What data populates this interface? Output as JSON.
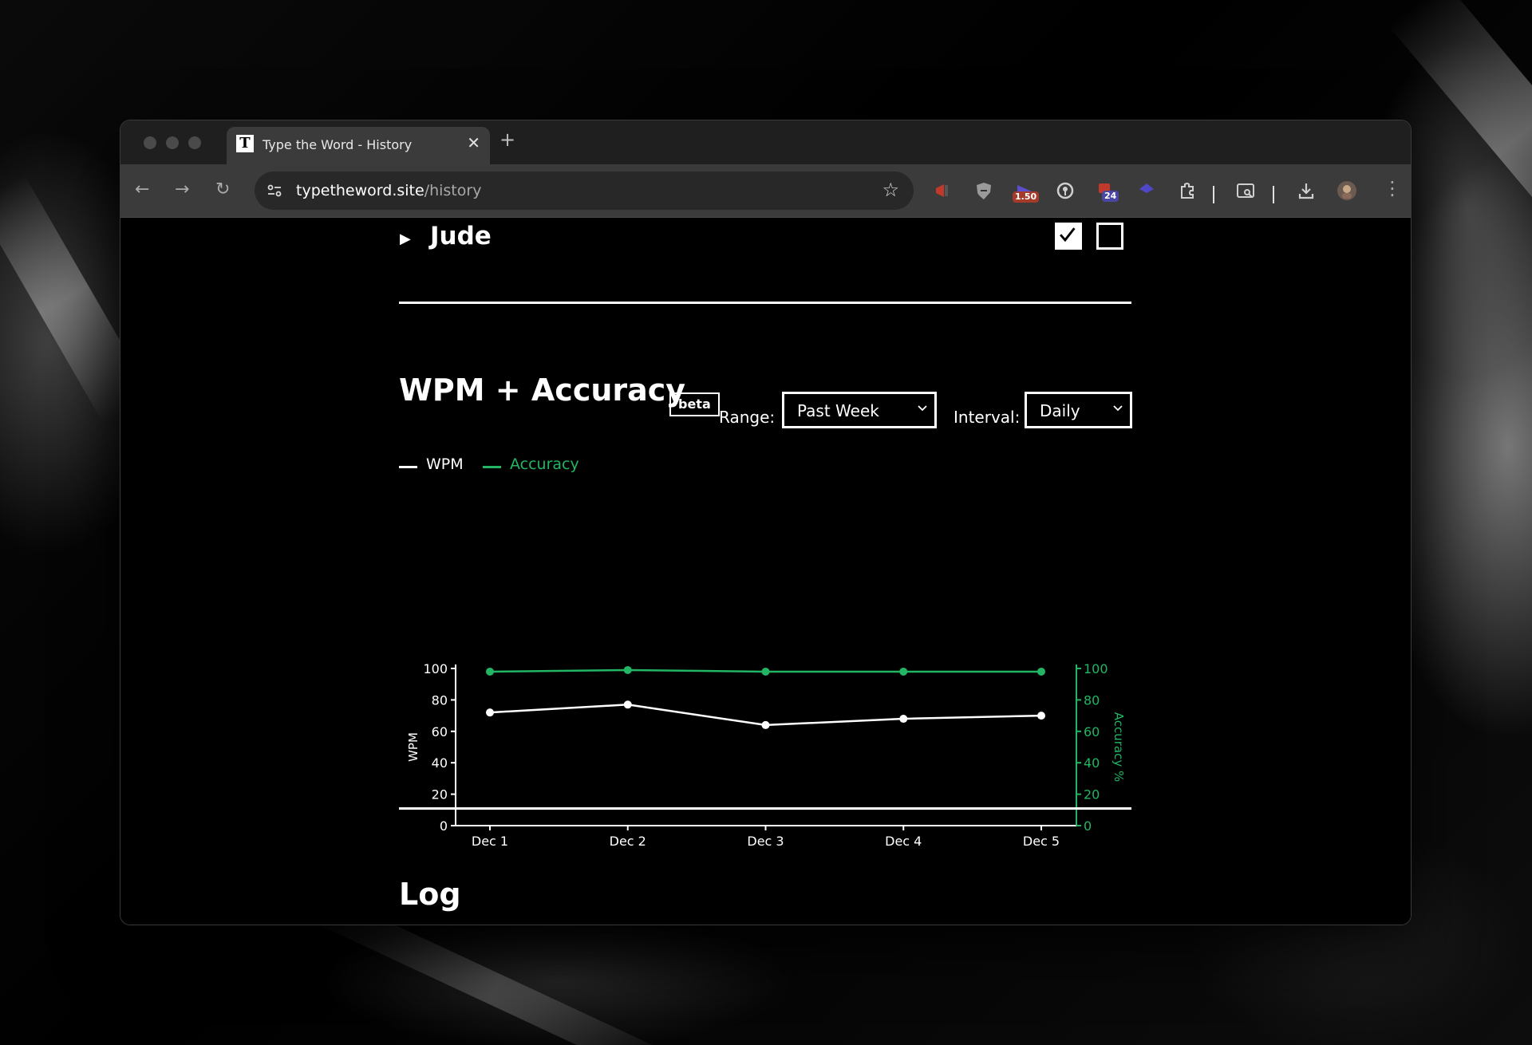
{
  "browser": {
    "tab": {
      "favicon": "T",
      "title": "Type the Word - History"
    },
    "url": {
      "host": "typetheword.site",
      "path": "/history"
    },
    "extensions": [
      {
        "name": "megaphone-extension-icon"
      },
      {
        "name": "shield-extension-icon"
      },
      {
        "name": "speed-extension-icon",
        "badge": "1.50"
      },
      {
        "name": "password-extension-icon"
      },
      {
        "name": "calendar-extension-icon",
        "badge": "24"
      },
      {
        "name": "diamond-extension-icon"
      }
    ]
  },
  "page": {
    "book": {
      "title": "Jude",
      "checked": true
    },
    "wpm_section": {
      "title": "WPM + Accuracy",
      "badge": "beta",
      "range_label": "Range:",
      "range_value": "Past Week",
      "interval_label": "Interval:",
      "interval_value": "Daily",
      "legend_wpm": "WPM",
      "legend_accuracy": "Accuracy"
    },
    "log_section": {
      "title": "Log"
    }
  },
  "colors": {
    "accuracy": "#22b564",
    "wpm": "#ffffff"
  },
  "chart_data": {
    "type": "line",
    "categories": [
      "Dec 1",
      "Dec 2",
      "Dec 3",
      "Dec 4",
      "Dec 5"
    ],
    "series": [
      {
        "name": "WPM",
        "axis": "left",
        "values": [
          72,
          77,
          64,
          68,
          70
        ]
      },
      {
        "name": "Accuracy",
        "axis": "right",
        "values": [
          98,
          99,
          98,
          98,
          98
        ]
      }
    ],
    "ylabel": "WPM",
    "ylim": [
      0,
      100
    ],
    "yticks": [
      "0",
      "20",
      "40",
      "60",
      "80",
      "100"
    ],
    "y2label": "Accuracy %",
    "y2lim": [
      0,
      100
    ],
    "y2ticks": [
      "0",
      "20",
      "40",
      "60",
      "80",
      "100"
    ],
    "grid": false,
    "legend": "top-left"
  }
}
